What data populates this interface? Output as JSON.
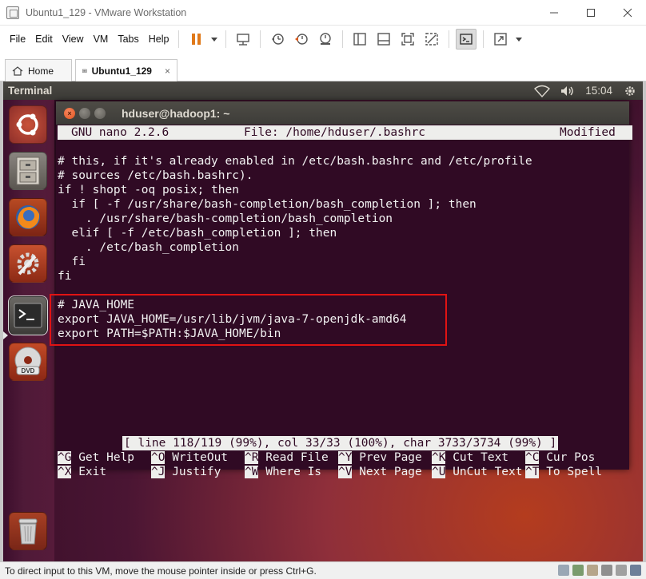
{
  "window": {
    "title": "Ubuntu1_129 - VMware Workstation"
  },
  "menu": [
    "File",
    "Edit",
    "View",
    "VM",
    "Tabs",
    "Help"
  ],
  "tabs": [
    {
      "label": "Home",
      "icon": "home-icon"
    },
    {
      "label": "Ubuntu1_129",
      "icon": "vm-icon",
      "close": "×"
    }
  ],
  "ubuntu_panel": {
    "app_name": "Terminal",
    "clock": "15:04"
  },
  "terminal": {
    "title": "hduser@hadoop1: ~",
    "nano_header": {
      "version": "GNU nano 2.2.6",
      "file": "File: /home/hduser/.bashrc",
      "state": "Modified"
    },
    "lines": [
      "",
      "# this, if it's already enabled in /etc/bash.bashrc and /etc/profile",
      "# sources /etc/bash.bashrc).",
      "if ! shopt -oq posix; then",
      "  if [ -f /usr/share/bash-completion/bash_completion ]; then",
      "    . /usr/share/bash-completion/bash_completion",
      "  elif [ -f /etc/bash_completion ]; then",
      "    . /etc/bash_completion",
      "  fi",
      "fi",
      "",
      "# JAVA_HOME",
      "export JAVA_HOME=/usr/lib/jvm/java-7-openjdk-amd64",
      "export PATH=$PATH:$JAVA_HOME/bin"
    ],
    "status": "[ line 118/119 (99%), col 33/33 (100%), char 3733/3734 (99%) ]",
    "shortcuts_row1": [
      {
        "key": "^G",
        "label": " Get Help"
      },
      {
        "key": "^O",
        "label": " WriteOut"
      },
      {
        "key": "^R",
        "label": " Read File"
      },
      {
        "key": "^Y",
        "label": " Prev Page"
      },
      {
        "key": "^K",
        "label": " Cut Text"
      },
      {
        "key": "^C",
        "label": " Cur Pos"
      }
    ],
    "shortcuts_row2": [
      {
        "key": "^X",
        "label": " Exit"
      },
      {
        "key": "^J",
        "label": " Justify"
      },
      {
        "key": "^W",
        "label": " Where Is"
      },
      {
        "key": "^V",
        "label": " Next Page"
      },
      {
        "key": "^U",
        "label": " UnCut Text"
      },
      {
        "key": "^T",
        "label": " To Spell"
      }
    ]
  },
  "statusbar": {
    "hint": "To direct input to this VM, move the mouse pointer inside or press Ctrl+G."
  },
  "colors": {
    "terminal_bg": "#300a24",
    "highlight": "#e01313",
    "accent_pause": "#e0791a"
  }
}
